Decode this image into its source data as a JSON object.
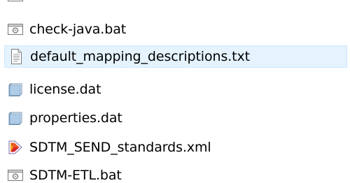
{
  "file_list": {
    "items": [
      {
        "label": "",
        "icon": "batch-file-icon",
        "partial": true,
        "selected": false
      },
      {
        "label": "check-java.bat",
        "icon": "batch-file-icon",
        "partial": false,
        "selected": false
      },
      {
        "label": "default_mapping_descriptions.txt",
        "icon": "text-document-icon",
        "partial": false,
        "selected": true
      },
      {
        "label": "license.dat",
        "icon": "data-file-icon",
        "partial": false,
        "selected": false
      },
      {
        "label": "properties.dat",
        "icon": "data-file-icon",
        "partial": false,
        "selected": false
      },
      {
        "label": "SDTM_SEND_standards.xml",
        "icon": "xml-file-icon",
        "partial": false,
        "selected": false
      },
      {
        "label": "SDTM-ETL.bat",
        "icon": "batch-file-icon",
        "partial": false,
        "selected": false
      }
    ]
  },
  "colors": {
    "selection_background": "#e5f3ff",
    "selection_border": "#cce8ff",
    "xml_icon_accent": "#d9262c"
  }
}
